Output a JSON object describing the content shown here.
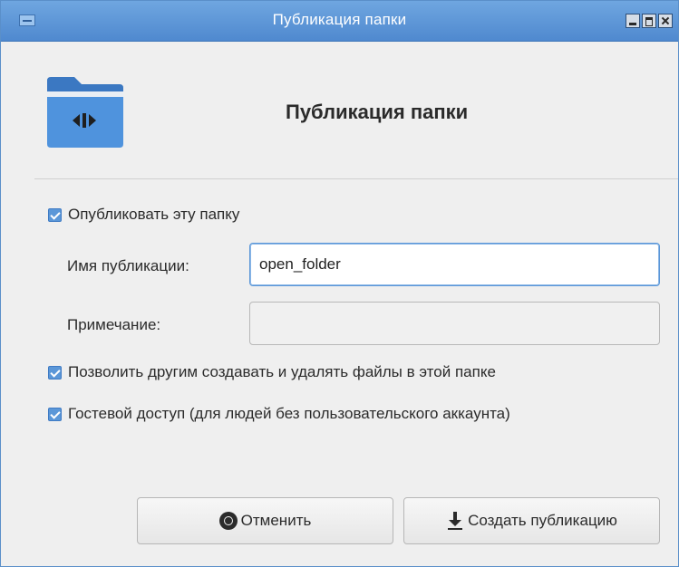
{
  "window": {
    "title": "Публикация папки"
  },
  "header": {
    "title": "Публикация папки",
    "icon": "folder-share-icon"
  },
  "options": {
    "publish": {
      "label": "Опубликовать эту папку",
      "checked": true
    },
    "allow_others": {
      "label": "Позволить другим создавать и удалять файлы в этой папке",
      "checked": true
    },
    "guest_access": {
      "label": "Гостевой доступ (для людей без пользовательского аккаунта)",
      "checked": true
    }
  },
  "fields": {
    "share_name": {
      "label": "Имя публикации:",
      "value": "open_folder"
    },
    "comment": {
      "label": "Примечание:",
      "value": ""
    }
  },
  "buttons": {
    "cancel": {
      "label": "Отменить",
      "icon": "cancel-icon"
    },
    "create": {
      "label": "Создать публикацию",
      "icon": "download-icon"
    }
  },
  "colors": {
    "titlebar": "#5b97d8",
    "accent": "#5b97d8",
    "folder": "#4a90e2"
  }
}
